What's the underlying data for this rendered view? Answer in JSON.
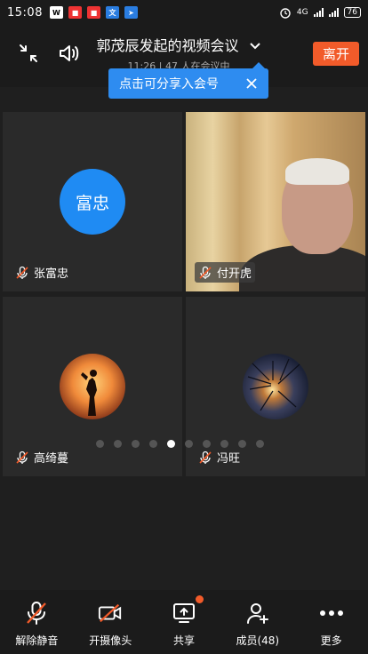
{
  "status_bar": {
    "time": "15:08",
    "network": "4G",
    "battery": "76",
    "app_icons": [
      "w-app-icon",
      "red-app-icon-1",
      "red-app-icon-2",
      "translate-app-icon",
      "blue-app-icon"
    ]
  },
  "header": {
    "title": "郭茂辰发起的视频会议",
    "subtitle": "11:26 | 47 人在会议中",
    "leave_label": "离开"
  },
  "tooltip": {
    "text": "点击可分享入会号"
  },
  "participants": [
    {
      "name": "张富忠",
      "avatar_text": "富忠",
      "muted": true,
      "type": "initials"
    },
    {
      "name": "付开虎",
      "muted": true,
      "type": "video"
    },
    {
      "name": "高绮蔓",
      "muted": true,
      "type": "photo"
    },
    {
      "name": "冯旺",
      "muted": true,
      "type": "photo"
    }
  ],
  "pager": {
    "count": 10,
    "active_index": 4
  },
  "toolbar": {
    "items": [
      {
        "label": "解除静音",
        "icon": "mic-off-icon"
      },
      {
        "label": "开摄像头",
        "icon": "camera-off-icon"
      },
      {
        "label": "共享",
        "icon": "share-screen-icon"
      },
      {
        "label": "成员(48)",
        "icon": "add-member-icon"
      },
      {
        "label": "更多",
        "icon": "more-icon"
      }
    ]
  },
  "colors": {
    "accent_blue": "#2e8cf0",
    "leave_orange": "#f25b2a",
    "background": "#1f1f1f",
    "tile": "#2a2a2a"
  }
}
